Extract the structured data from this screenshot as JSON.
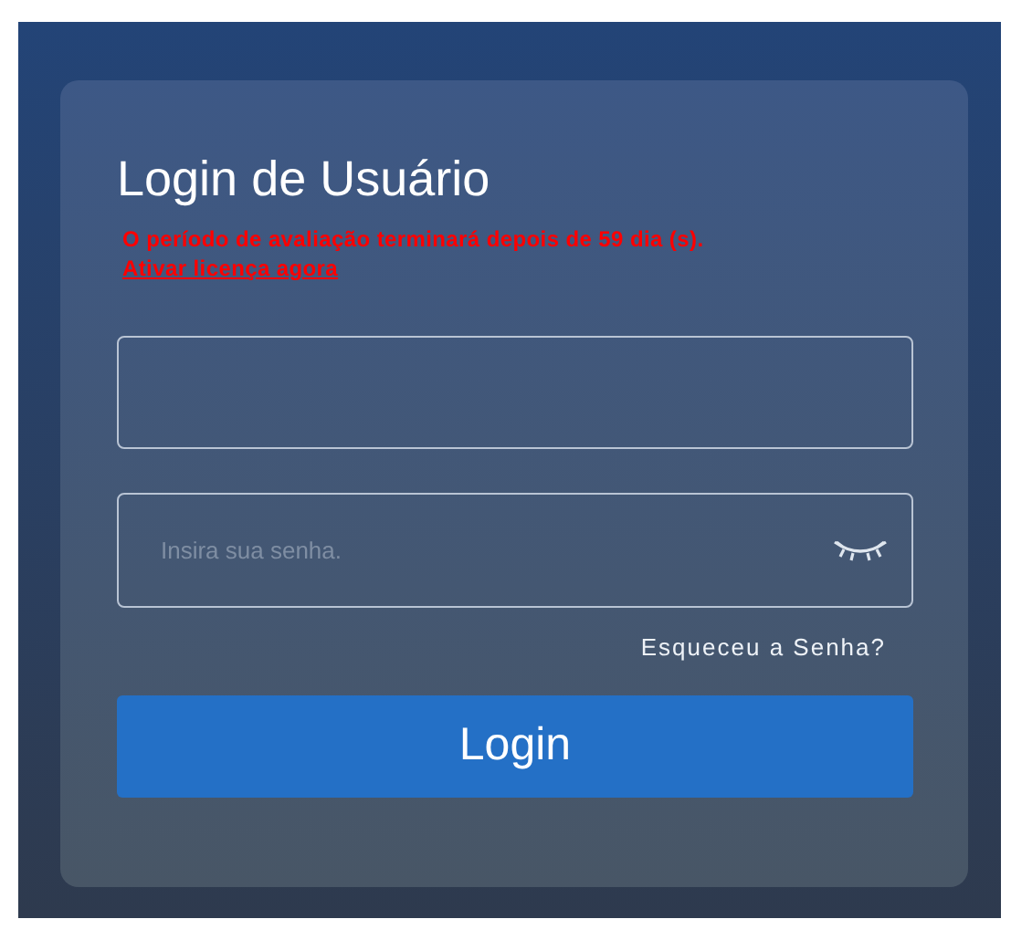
{
  "title": "Login de Usuário",
  "notice": {
    "text": "O período de avaliação terminará depois de 59 dia (s).",
    "link": "Ativar licença agora"
  },
  "password": {
    "placeholder": "Insira sua senha."
  },
  "forgot_link": "Esqueceu a Senha?",
  "login_button": "Login"
}
